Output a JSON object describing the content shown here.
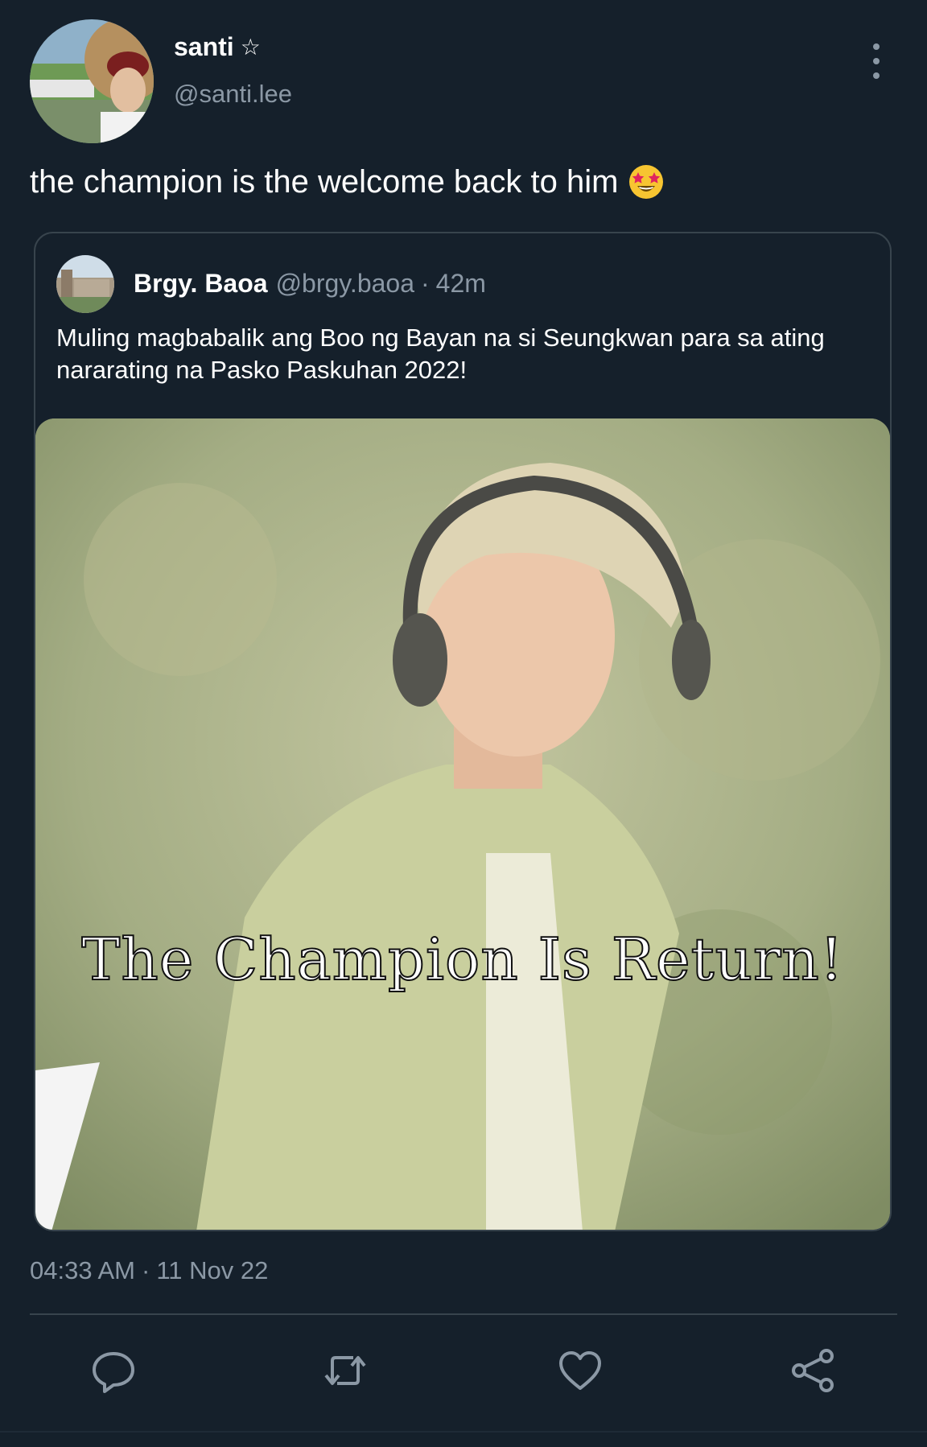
{
  "tweet": {
    "author": {
      "display_name": "santi",
      "badge_icon": "star-outline-icon",
      "handle": "@santi.lee"
    },
    "text": "the champion is the welcome back to him",
    "emoji_icon": "star-struck-emoji-icon",
    "timestamp_time": "04:33 AM",
    "timestamp_sep": "·",
    "timestamp_date": "11 Nov 22"
  },
  "quoted": {
    "display_name": "Brgy. Baoa",
    "handle": "@brgy.baoa",
    "sep": "·",
    "time": "42m",
    "text": "Muling magbabalik ang Boo ng Bayan na si Seungkwan para sa ating nararating na Pasko Paskuhan 2022!",
    "media_caption": "The Champion Is Return!"
  },
  "actions": [
    {
      "name": "reply",
      "icon": "reply-icon"
    },
    {
      "name": "retweet",
      "icon": "retweet-icon"
    },
    {
      "name": "like",
      "icon": "heart-icon"
    },
    {
      "name": "share",
      "icon": "share-icon"
    }
  ],
  "colors": {
    "background": "#15202b",
    "secondary_text": "#8b98a5",
    "border": "#38444d"
  }
}
